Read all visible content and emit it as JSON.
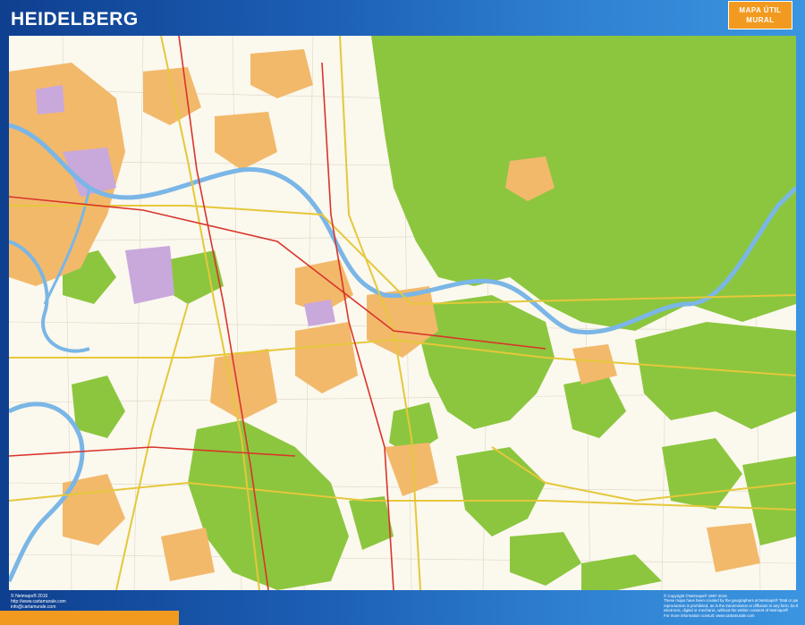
{
  "title": "HEIDELBERG",
  "badge": {
    "line1": "MAPA ÚTIL",
    "line2": "MURAL"
  },
  "footer_left": [
    "© Netmaps® 2016",
    "http://www.cartamurale.com",
    "info@cartamurale.com"
  ],
  "footer_right": [
    "© Copyright ©Netmaps® 1997-2016",
    "These maps have been created by the geographers at Netmaps® Total or partial",
    "reproduction is prohibited, as is the transmission or diffusion in any form, be that",
    "electronic, digital or mechanic, without the written consent of Netmaps®",
    "For more information consult: www.cartamurale.com"
  ],
  "colors": {
    "frame": "#1c5fb5",
    "badge": "#f29a1f",
    "map_bg": "#fbf8ee",
    "forest": "#8cc63e",
    "urban": "#f2b96b",
    "water": "#7ab6e6",
    "road": "#e5c83a",
    "main_road": "#d9342b"
  }
}
